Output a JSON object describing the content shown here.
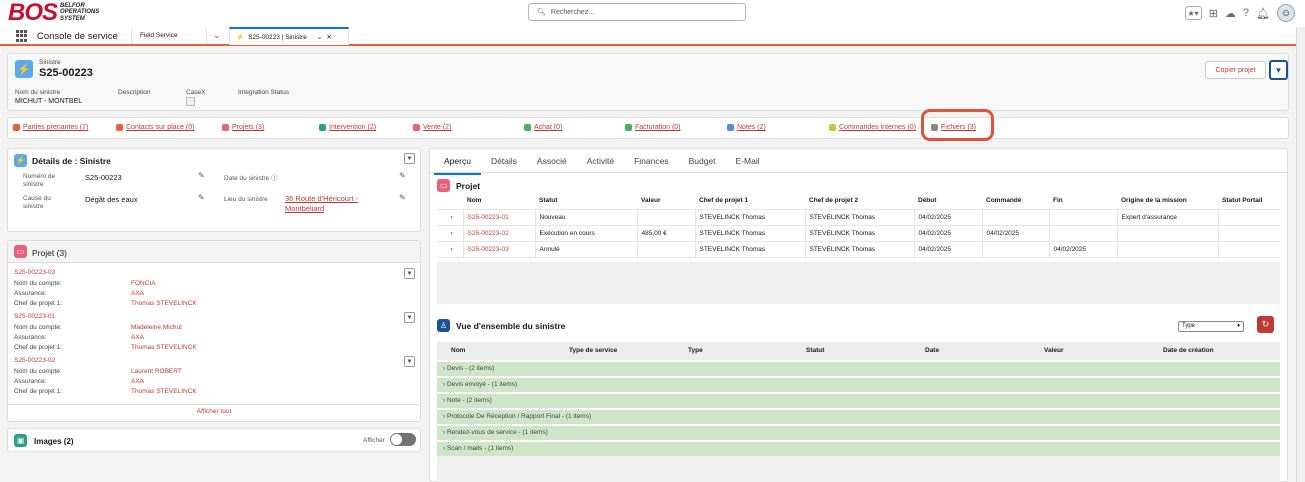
{
  "brand": {
    "logo": "BOS",
    "line1": "BELFOR",
    "line2": "OPERATIONS",
    "line3": "SYSTEM"
  },
  "search": {
    "placeholder": "Recherchez..."
  },
  "nav": {
    "app_name": "Console de service",
    "tab1": "Field Service",
    "tab2": "S25-00223 | Sinistre"
  },
  "record": {
    "object": "Sinistre",
    "name": "S25-00223",
    "copy_button": "Copier projet",
    "fields": [
      {
        "label": "Nom du sinistre",
        "value": "MICHUT - MONTBEL"
      },
      {
        "label": "Description",
        "value": ""
      },
      {
        "label": "CaseX",
        "value": ""
      },
      {
        "label": "Integration Status",
        "value": ""
      }
    ]
  },
  "related": [
    {
      "label": "Parties prenantes (7)",
      "color": "#e8603c"
    },
    {
      "label": "Contacts sur place (0)",
      "color": "#e8603c"
    },
    {
      "label": "Projets (3)",
      "color": "#e8607c"
    },
    {
      "label": "Intervention (2)",
      "color": "#2a9e8b"
    },
    {
      "label": "Vente (2)",
      "color": "#e8607c"
    },
    {
      "label": "Achat (0)",
      "color": "#4bb05a"
    },
    {
      "label": "Facturation (0)",
      "color": "#4bb05a"
    },
    {
      "label": "Notes (2)",
      "color": "#5a8ae8"
    },
    {
      "label": "Commandes internes (0)",
      "color": "#c6c63a"
    },
    {
      "label": "Fichiers (3)",
      "color": "#888888"
    }
  ],
  "details": {
    "title": "Détails de : Sinistre",
    "num_label": "Numéro de sinistre",
    "num_value": "S25-00223",
    "date_label": "Date du sinistre",
    "cause_label": "Cause du sinistre",
    "cause_value": "Dégât des eaux",
    "lieu_label": "Lieu du sinistre",
    "lieu_value": "36 Route d'Héricourt - Montbéliard"
  },
  "projets": {
    "title": "Projet (3)",
    "show_all": "Afficher tout",
    "items": [
      {
        "id": "S25-00223-03",
        "compte": "FONCIA",
        "assurance": "AXA",
        "chef": "Thomas STEVELINCK"
      },
      {
        "id": "S25-00223-01",
        "compte": "Madeleine Michut",
        "assurance": "AXA",
        "chef": "Thomas STEVELINCK"
      },
      {
        "id": "S25-00223-02",
        "compte": "Laurent ROBERT",
        "assurance": "AXA",
        "chef": "Thomas STEVELINCK"
      }
    ],
    "labels": {
      "compte": "Nom du compte:",
      "assurance": "Assurance:",
      "chef": "Chef de projet 1:"
    }
  },
  "images": {
    "title": "Images (2)",
    "toggle_label": "Afficher"
  },
  "tabs": [
    "Aperçu",
    "Détails",
    "Associé",
    "Activité",
    "Finances",
    "Budget",
    "E-Mail"
  ],
  "projet_table": {
    "title": "Projet",
    "columns": [
      "Nom",
      "Statut",
      "Valeur",
      "Chef de projet 1",
      "Chef de projet 2",
      "Début",
      "Commandé",
      "Fin",
      "Origine de la mission",
      "Statut Portail"
    ],
    "rows": [
      [
        "S25-00223-01",
        "Nouveau",
        "",
        "STEVELINCK Thomas",
        "STEVELINCK Thomas",
        "04/02/2025",
        "",
        "",
        "Expert d'assurance",
        ""
      ],
      [
        "S25-00223-02",
        "Exécution en cours",
        "485,00 €",
        "STEVELINCK Thomas",
        "STEVELINCK Thomas",
        "04/02/2025",
        "04/02/2025",
        "",
        "",
        ""
      ],
      [
        "S25-00223-03",
        "Annulé",
        "",
        "STEVELINCK Thomas",
        "STEVELINCK Thomas",
        "04/02/2025",
        "",
        "04/02/2025",
        "",
        ""
      ]
    ]
  },
  "vue": {
    "title": "Vue d'ensemble du sinistre",
    "select": "Type",
    "columns": [
      "Nom",
      "Type de service",
      "Type",
      "Statut",
      "Date",
      "Valeur",
      "Date de création"
    ],
    "groups": [
      "Devis - (2 items)",
      "Devis envoyé - (1 items)",
      "Note - (2 items)",
      "Protocole De Réception / Rapport Final - (1 items)",
      "Rendez-vous de service - (1 items)",
      "Scan / mails - (1 items)"
    ]
  }
}
